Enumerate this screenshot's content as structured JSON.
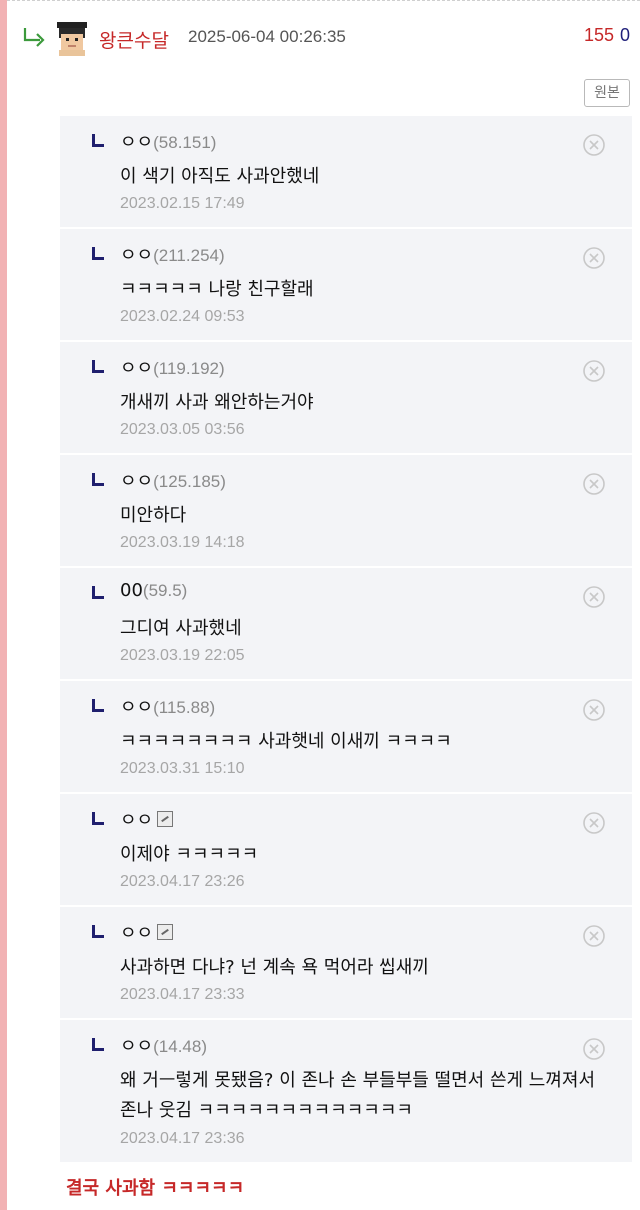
{
  "header": {
    "nickname": "왕큰수달",
    "date": "2025-06-04 00:26:35",
    "upvotes": "155",
    "downvotes": "0"
  },
  "original_button": "원본",
  "replies": [
    {
      "name": "ㅇㅇ",
      "ip": "(58.151)",
      "text": "이 색기 아직도 사과안했네",
      "time": "2023.02.15 17:49"
    },
    {
      "name": "ㅇㅇ",
      "ip": "(211.254)",
      "text": "ㅋㅋㅋㅋㅋ 나랑 친구할래",
      "time": "2023.02.24 09:53"
    },
    {
      "name": "ㅇㅇ",
      "ip": "(119.192)",
      "text": "개새끼 사과 왜안하는거야",
      "time": "2023.03.05 03:56"
    },
    {
      "name": "ㅇㅇ",
      "ip": "(125.185)",
      "text": "미안하다",
      "time": "2023.03.19 14:18"
    },
    {
      "name": "00",
      "ip": "(59.5)",
      "text": "그디여 사과했네",
      "time": "2023.03.19 22:05"
    },
    {
      "name": "ㅇㅇ",
      "ip": "(115.88)",
      "text": "ㅋㅋㅋㅋㅋㅋㅋㅋ 사과햇네 이새끼 ㅋㅋㅋㅋ",
      "time": "2023.03.31 15:10"
    },
    {
      "name": "ㅇㅇ",
      "ip": "",
      "text": "이제야 ㅋㅋㅋㅋㅋ",
      "time": "2023.04.17 23:26"
    },
    {
      "name": "ㅇㅇ",
      "ip": "",
      "text": "사과하면 다냐? 넌 계속 욕 먹어라 씹새끼",
      "time": "2023.04.17 23:33"
    },
    {
      "name": "ㅇㅇ",
      "ip": "(14.48)",
      "text": "왜 거ㅡ렇게 못됐음? 이 존나 손 부들부들 떨면서 쓴게 느껴져서 존나 웃김 ㅋㅋㅋㅋㅋㅋㅋㅋㅋㅋㅋㅋㅋ",
      "time": "2023.04.17 23:36"
    }
  ],
  "footer": "결국 사과함 ㅋㅋㅋㅋㅋ",
  "colors": {
    "accent_red": "#c62828",
    "reply_bg": "#f3f4f7",
    "left_bar": "#f2b2b4"
  }
}
